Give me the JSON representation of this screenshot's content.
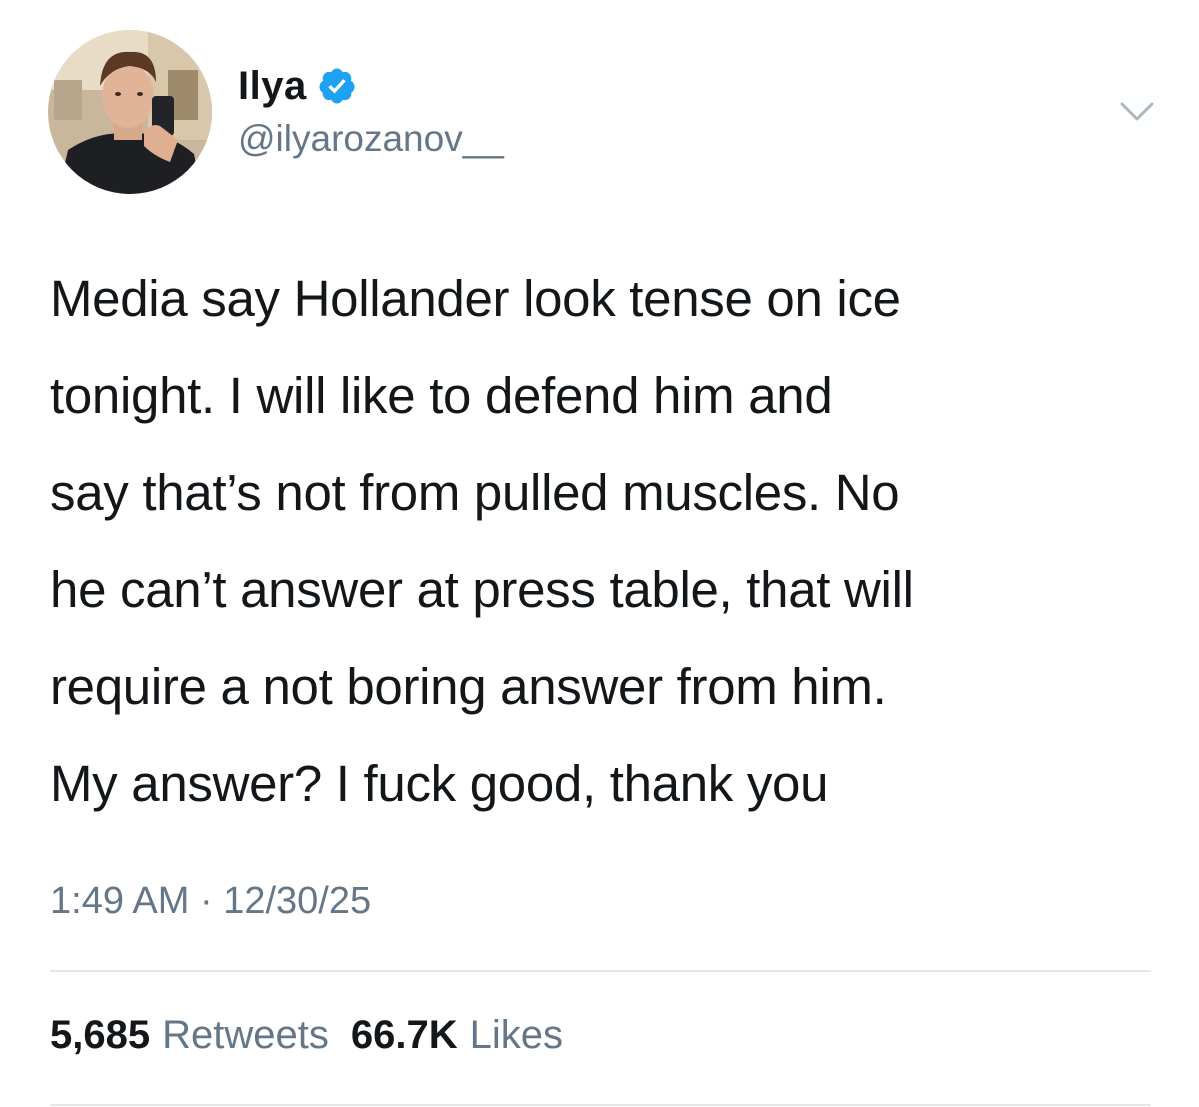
{
  "tweet": {
    "author": {
      "display_name": "Ilya",
      "handle": "@ilyarozanov__",
      "verified": true,
      "verified_color": "#1da1f2"
    },
    "text": "Media say Hollander look tense on ice\ntonight. I will like to defend him and\nsay that’s not from pulled muscles. No\nhe can’t answer at press table, that will\nrequire a not boring answer from him.\nMy answer? I fuck good, thank you",
    "time": "1:49 AM",
    "separator": "·",
    "date": "12/30/25",
    "stats": {
      "retweets_count": "5,685",
      "retweets_label": "Retweets",
      "likes_count": "66.7K",
      "likes_label": "Likes"
    },
    "icons": {
      "verified": "verified-badge-icon",
      "menu": "chevron-down-icon"
    }
  }
}
